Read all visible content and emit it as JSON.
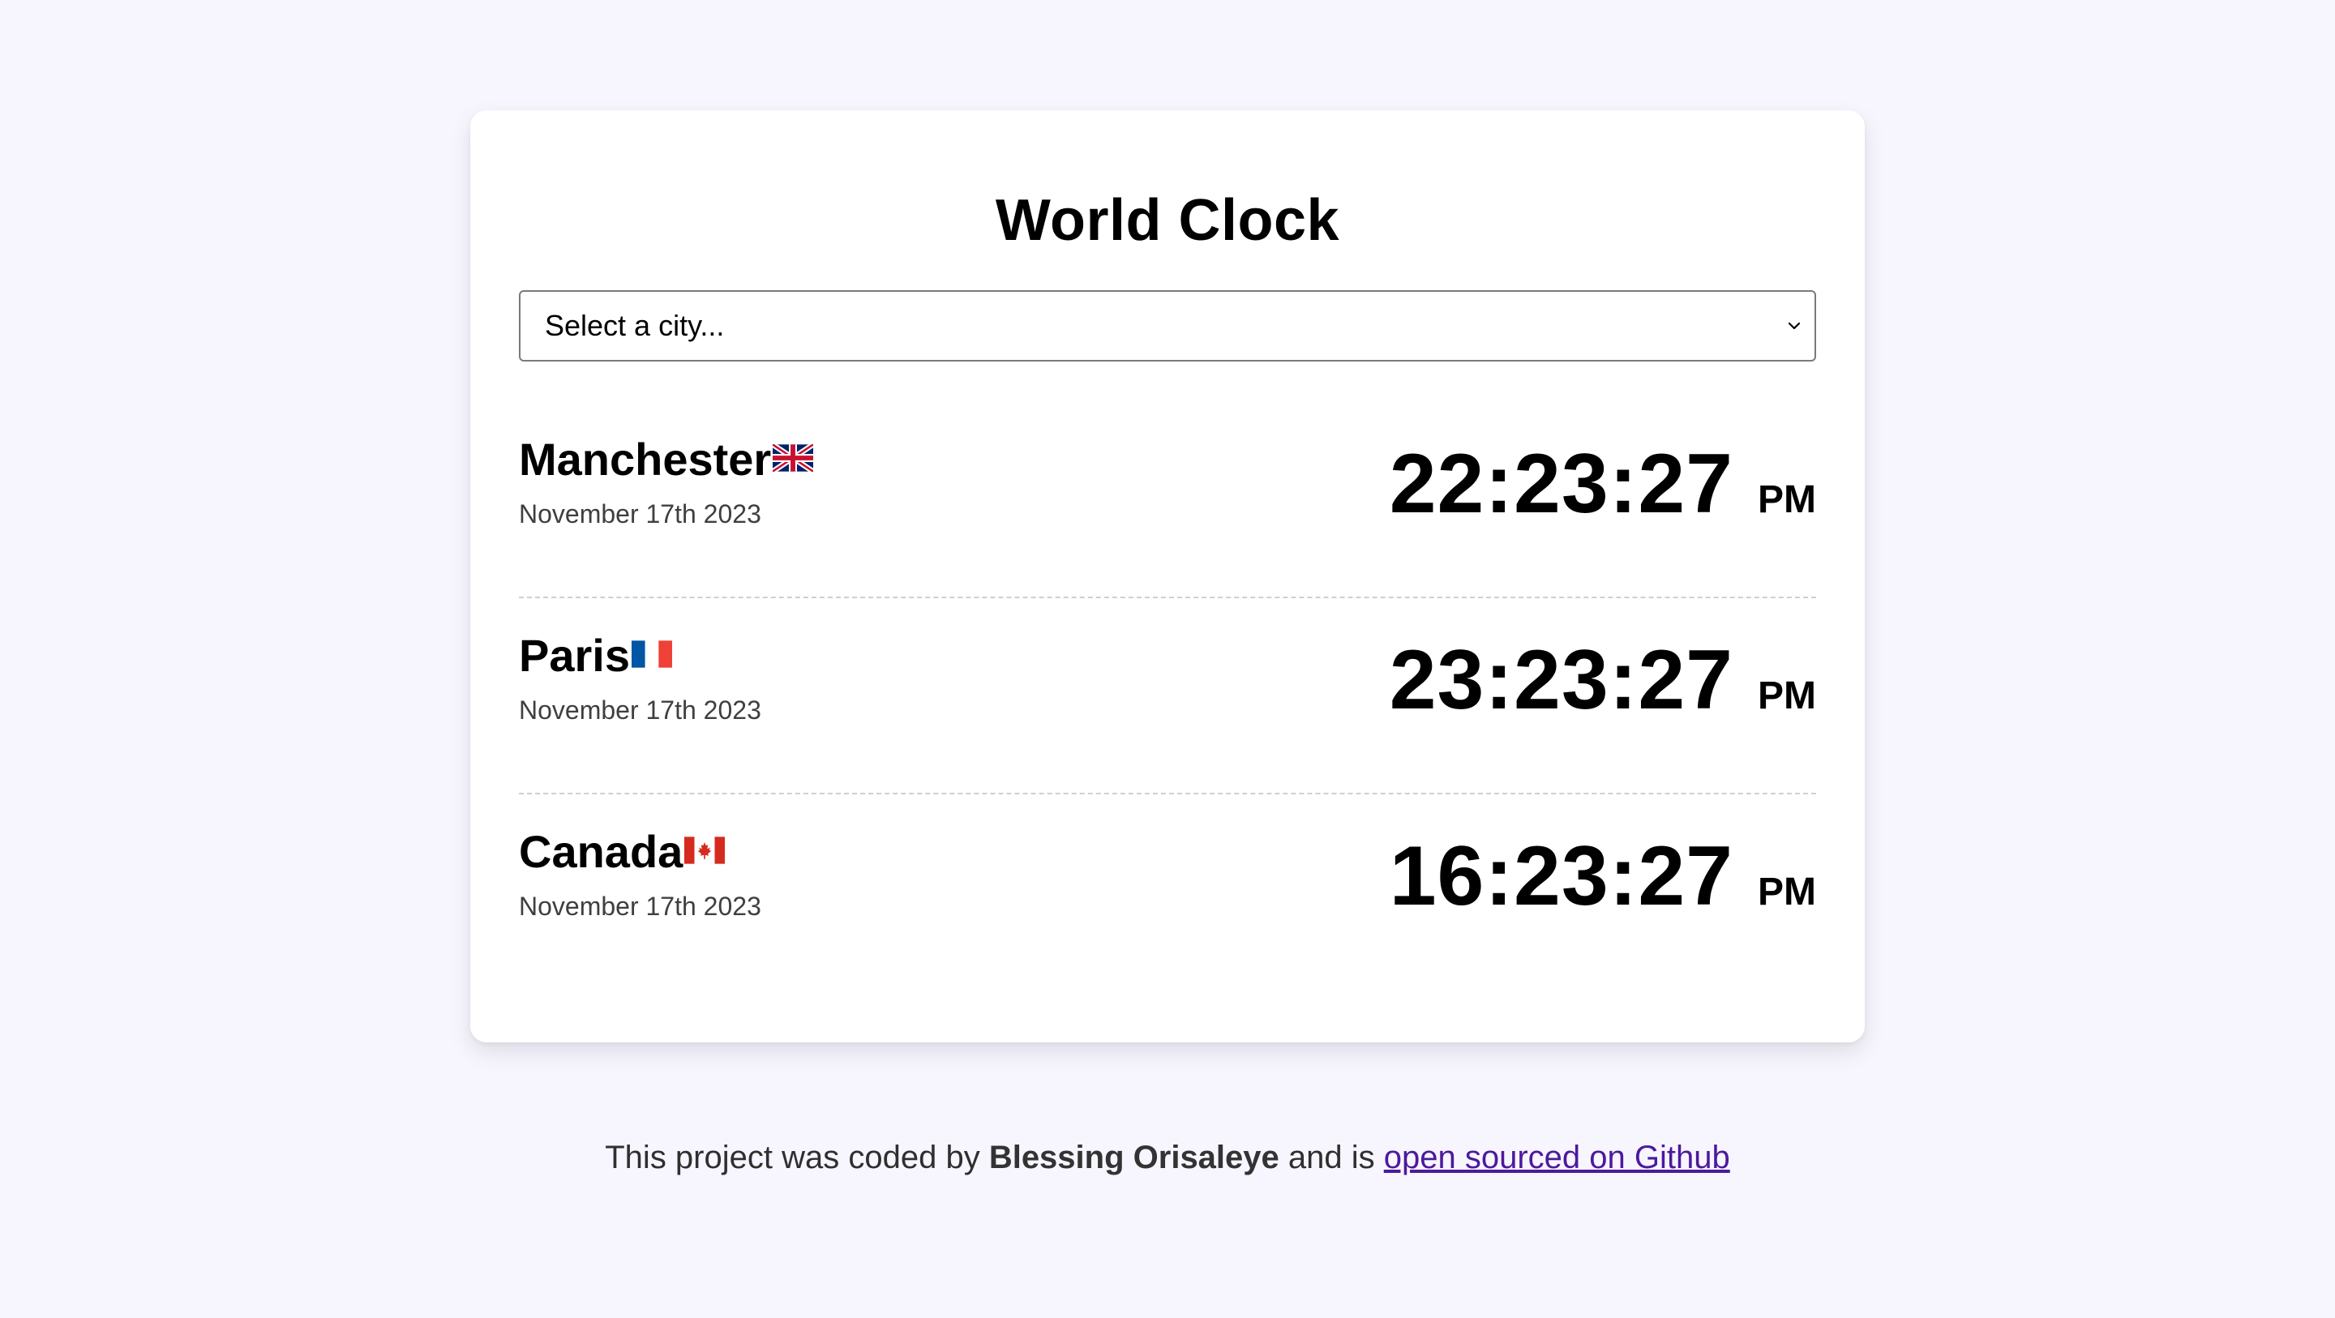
{
  "title": "World Clock",
  "select": {
    "value": "Select a city..."
  },
  "cities": [
    {
      "name": "Manchester",
      "flag": "uk-flag",
      "date": "November 17th 2023",
      "time": "22:23:27",
      "ampm": "PM"
    },
    {
      "name": "Paris",
      "flag": "france-flag",
      "date": "November 17th 2023",
      "time": "23:23:27",
      "ampm": "PM"
    },
    {
      "name": "Canada",
      "flag": "canada-flag",
      "date": "November 17th 2023",
      "time": "16:23:27",
      "ampm": "PM"
    }
  ],
  "footer": {
    "prefix": "This project was coded by ",
    "author": "Blessing Orisaleye",
    "middle": " and is ",
    "link_text": "open sourced on Github"
  },
  "colors": {
    "background": "#f7f5fe",
    "card": "#ffffff",
    "link": "#4b1a9c",
    "date_text": "#3f3f3f",
    "separator": "#cfcfcf"
  }
}
